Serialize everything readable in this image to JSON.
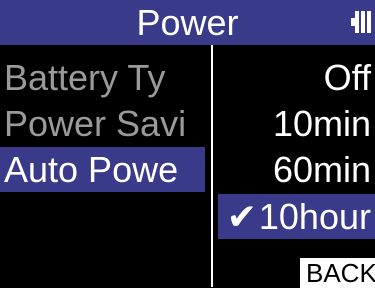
{
  "header": {
    "title": "Power",
    "battery_icon": "battery-icon"
  },
  "menu": {
    "items": [
      {
        "label": "Battery Ty"
      },
      {
        "label": "Power Savi"
      },
      {
        "label": "Auto Powe"
      }
    ]
  },
  "options": {
    "items": [
      {
        "label": "Off"
      },
      {
        "label": "10min"
      },
      {
        "label": "60min"
      },
      {
        "label": "10hour"
      }
    ],
    "check_glyph": "✔"
  },
  "footer": {
    "back_label": "BACK"
  },
  "colors": {
    "accent": "#3a3a8a",
    "background": "#000000",
    "text": "#ffffff",
    "dim_text": "#9a9a9a"
  }
}
